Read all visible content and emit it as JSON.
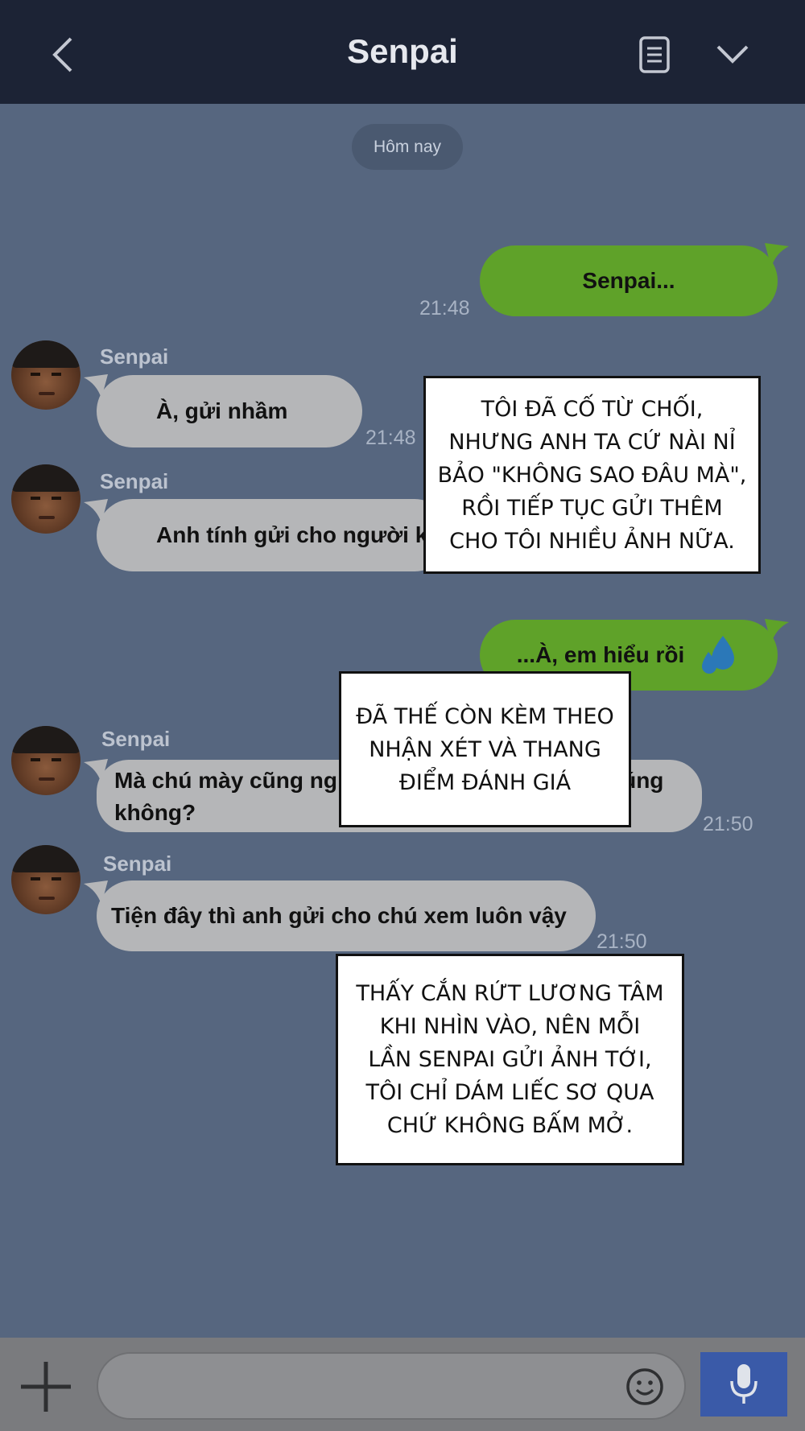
{
  "header": {
    "title": "Senpai",
    "back_icon": "chevron-left-icon",
    "note_icon": "note-icon",
    "menu_icon": "chevron-down-icon"
  },
  "date_divider": "Hôm nay",
  "messages": [
    {
      "side": "out",
      "text": "Senpai...",
      "time": "21:48"
    },
    {
      "side": "in",
      "sender": "Senpai",
      "text": "À, gửi nhầm",
      "time": "21:48"
    },
    {
      "side": "in",
      "sender": "Senpai",
      "text": "Anh tính gửi cho người k"
    },
    {
      "side": "out",
      "text": "...À, em hiểu rồi",
      "emoji": "sweat-drops-icon"
    },
    {
      "side": "in",
      "sender": "Senpai",
      "text_line1": "Mà chú mày cũng ng",
      "text_line1_end": "đúng",
      "text_line2": "không?",
      "time": "21:50"
    },
    {
      "side": "in",
      "sender": "Senpai",
      "text": "Tiện đây thì anh gửi cho chú xem luôn vậy",
      "time": "21:50"
    }
  ],
  "captions": [
    "Tôi đã cố từ chối, nhưng anh ta cứ nài nỉ bảo \"không sao đâu mà\", rồi tiếp tục gửi thêm cho tôi nhiều ảnh nữa.",
    "Đã thế còn kèm theo nhận xét và thang điểm đánh giá",
    "Thấy cắn rứt lương tâm khi nhìn vào, nên mỗi lần senpai gửi ảnh tới, tôi chỉ dám liếc sơ qua chứ không bấm mở."
  ],
  "input_bar": {
    "plus_icon": "plus-icon",
    "emoji_icon": "smiley-icon",
    "mic_icon": "microphone-icon"
  },
  "colors": {
    "header": "#1c2335",
    "background": "#56667f",
    "outgoing": "#5fa229",
    "incoming": "#b5b6b8",
    "mic": "#3a5aa8"
  }
}
